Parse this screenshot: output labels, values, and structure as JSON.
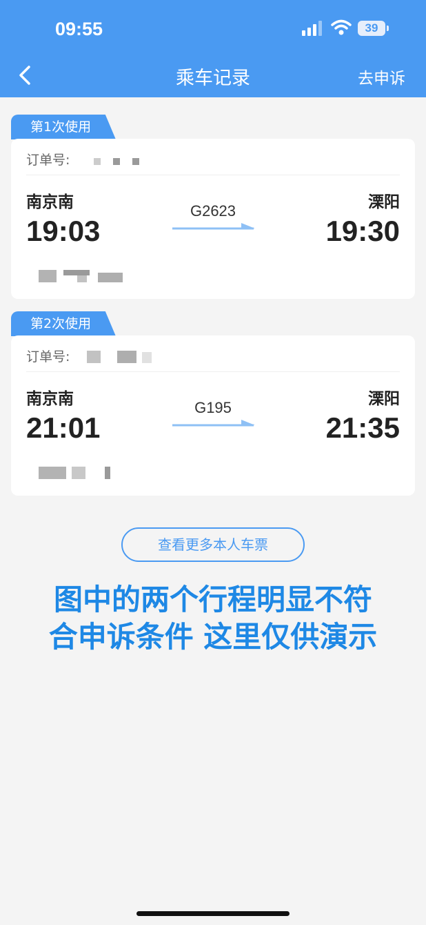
{
  "status_bar": {
    "time": "09:55",
    "battery": "39"
  },
  "nav": {
    "title": "乘车记录",
    "action": "去申诉",
    "back_icon": "chevron-left-icon"
  },
  "records": [
    {
      "tag": "第1次使用",
      "order_label": "订单号:",
      "from_station": "南京南",
      "to_station": "溧阳",
      "departure_time": "19:03",
      "arrival_time": "19:30",
      "train_no": "G2623"
    },
    {
      "tag": "第2次使用",
      "order_label": "订单号:",
      "from_station": "南京南",
      "to_station": "溧阳",
      "departure_time": "21:01",
      "arrival_time": "21:35",
      "train_no": "G195"
    }
  ],
  "more_button": "查看更多本人车票",
  "note": {
    "line1": "图中的两个行程明显不符",
    "line2": "合申诉条件 这里仅供演示"
  },
  "colors": {
    "primary": "#4a9af2",
    "note": "#1e88e5",
    "background": "#f4f4f4"
  }
}
